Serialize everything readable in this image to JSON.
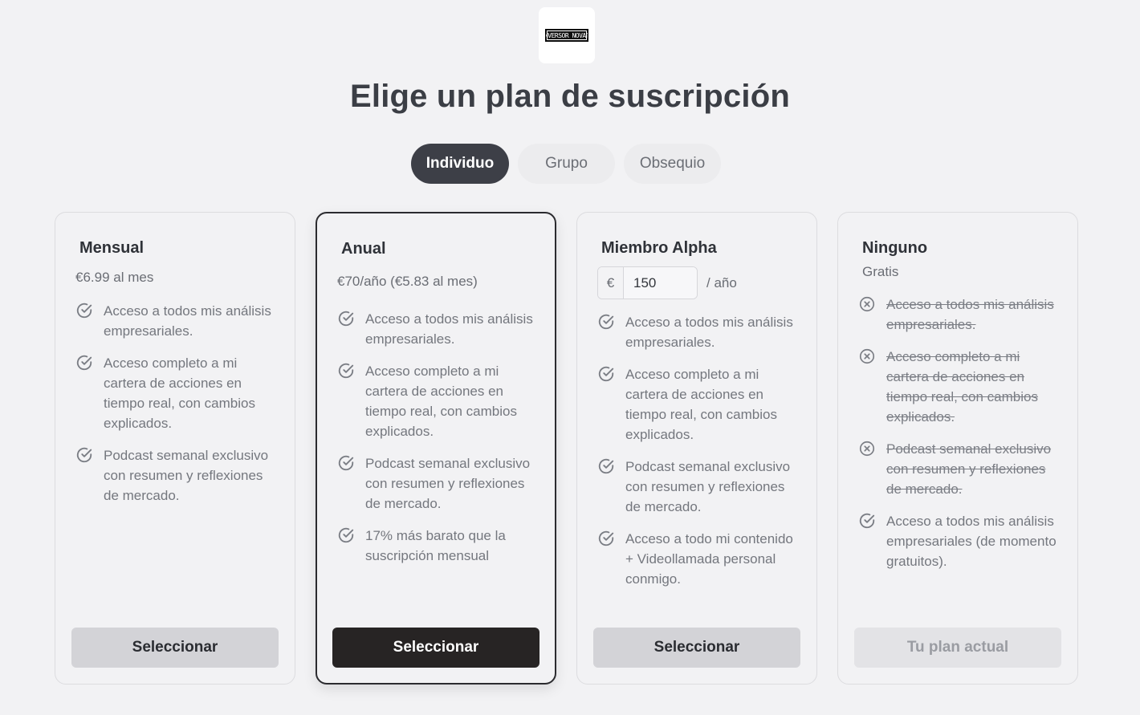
{
  "logo": {
    "text": "INVERSOR NOVATO"
  },
  "page_title": "Elige un plan de suscripción",
  "tabs": [
    {
      "label": "Individuo",
      "active": true
    },
    {
      "label": "Grupo",
      "active": false
    },
    {
      "label": "Obsequio",
      "active": false
    }
  ],
  "plans": [
    {
      "name": "Mensual",
      "price": "€6.99 al mes",
      "features": [
        {
          "text": "Acceso a todos mis análisis empresariales.",
          "included": true
        },
        {
          "text": "Acceso completo a mi cartera de acciones en tiempo real, con cambios explicados.",
          "included": true
        },
        {
          "text": "Podcast semanal exclusivo con resumen y reflexiones de mercado.",
          "included": true
        }
      ],
      "button": "Seleccionar"
    },
    {
      "name": "Anual",
      "price": "€70/año (€5.83 al mes)",
      "features": [
        {
          "text": "Acceso a todos mis análisis empresariales.",
          "included": true
        },
        {
          "text": "Acceso completo a mi cartera de acciones en tiempo real, con cambios explicados.",
          "included": true
        },
        {
          "text": "Podcast semanal exclusivo con resumen y reflexiones de mercado.",
          "included": true
        },
        {
          "text": "17% más barato que la suscripción mensual",
          "included": true
        }
      ],
      "button": "Seleccionar"
    },
    {
      "name": "Miembro Alpha",
      "input": {
        "prefix": "€",
        "value": "150",
        "suffix": "/ año"
      },
      "features": [
        {
          "text": "Acceso a todos mis análisis empresariales.",
          "included": true
        },
        {
          "text": "Acceso completo a mi cartera de acciones en tiempo real, con cambios explicados.",
          "included": true
        },
        {
          "text": "Podcast semanal exclusivo con resumen y reflexiones de mercado.",
          "included": true
        },
        {
          "text": "Acceso a todo mi contenido + Videollamada personal conmigo.",
          "included": true
        }
      ],
      "button": "Seleccionar"
    },
    {
      "name": "Ninguno",
      "price": "Gratis",
      "features": [
        {
          "text": "Acceso a todos mis análisis empresariales.",
          "included": false
        },
        {
          "text": "Acceso completo a mi cartera de acciones en tiempo real, con cambios explicados.",
          "included": false
        },
        {
          "text": "Podcast semanal exclusivo con resumen y reflexiones de mercado.",
          "included": false
        },
        {
          "text": "Acceso a todos mis análisis empresariales (de momento gratuitos).",
          "included": true
        }
      ],
      "button": "Tu plan actual"
    }
  ],
  "colors": {
    "background": "#f2f2f4",
    "tab_active": "#3d3f47",
    "button_primary": "#272424",
    "button_secondary": "#d3d3d7",
    "icon": "#7a7d84"
  }
}
